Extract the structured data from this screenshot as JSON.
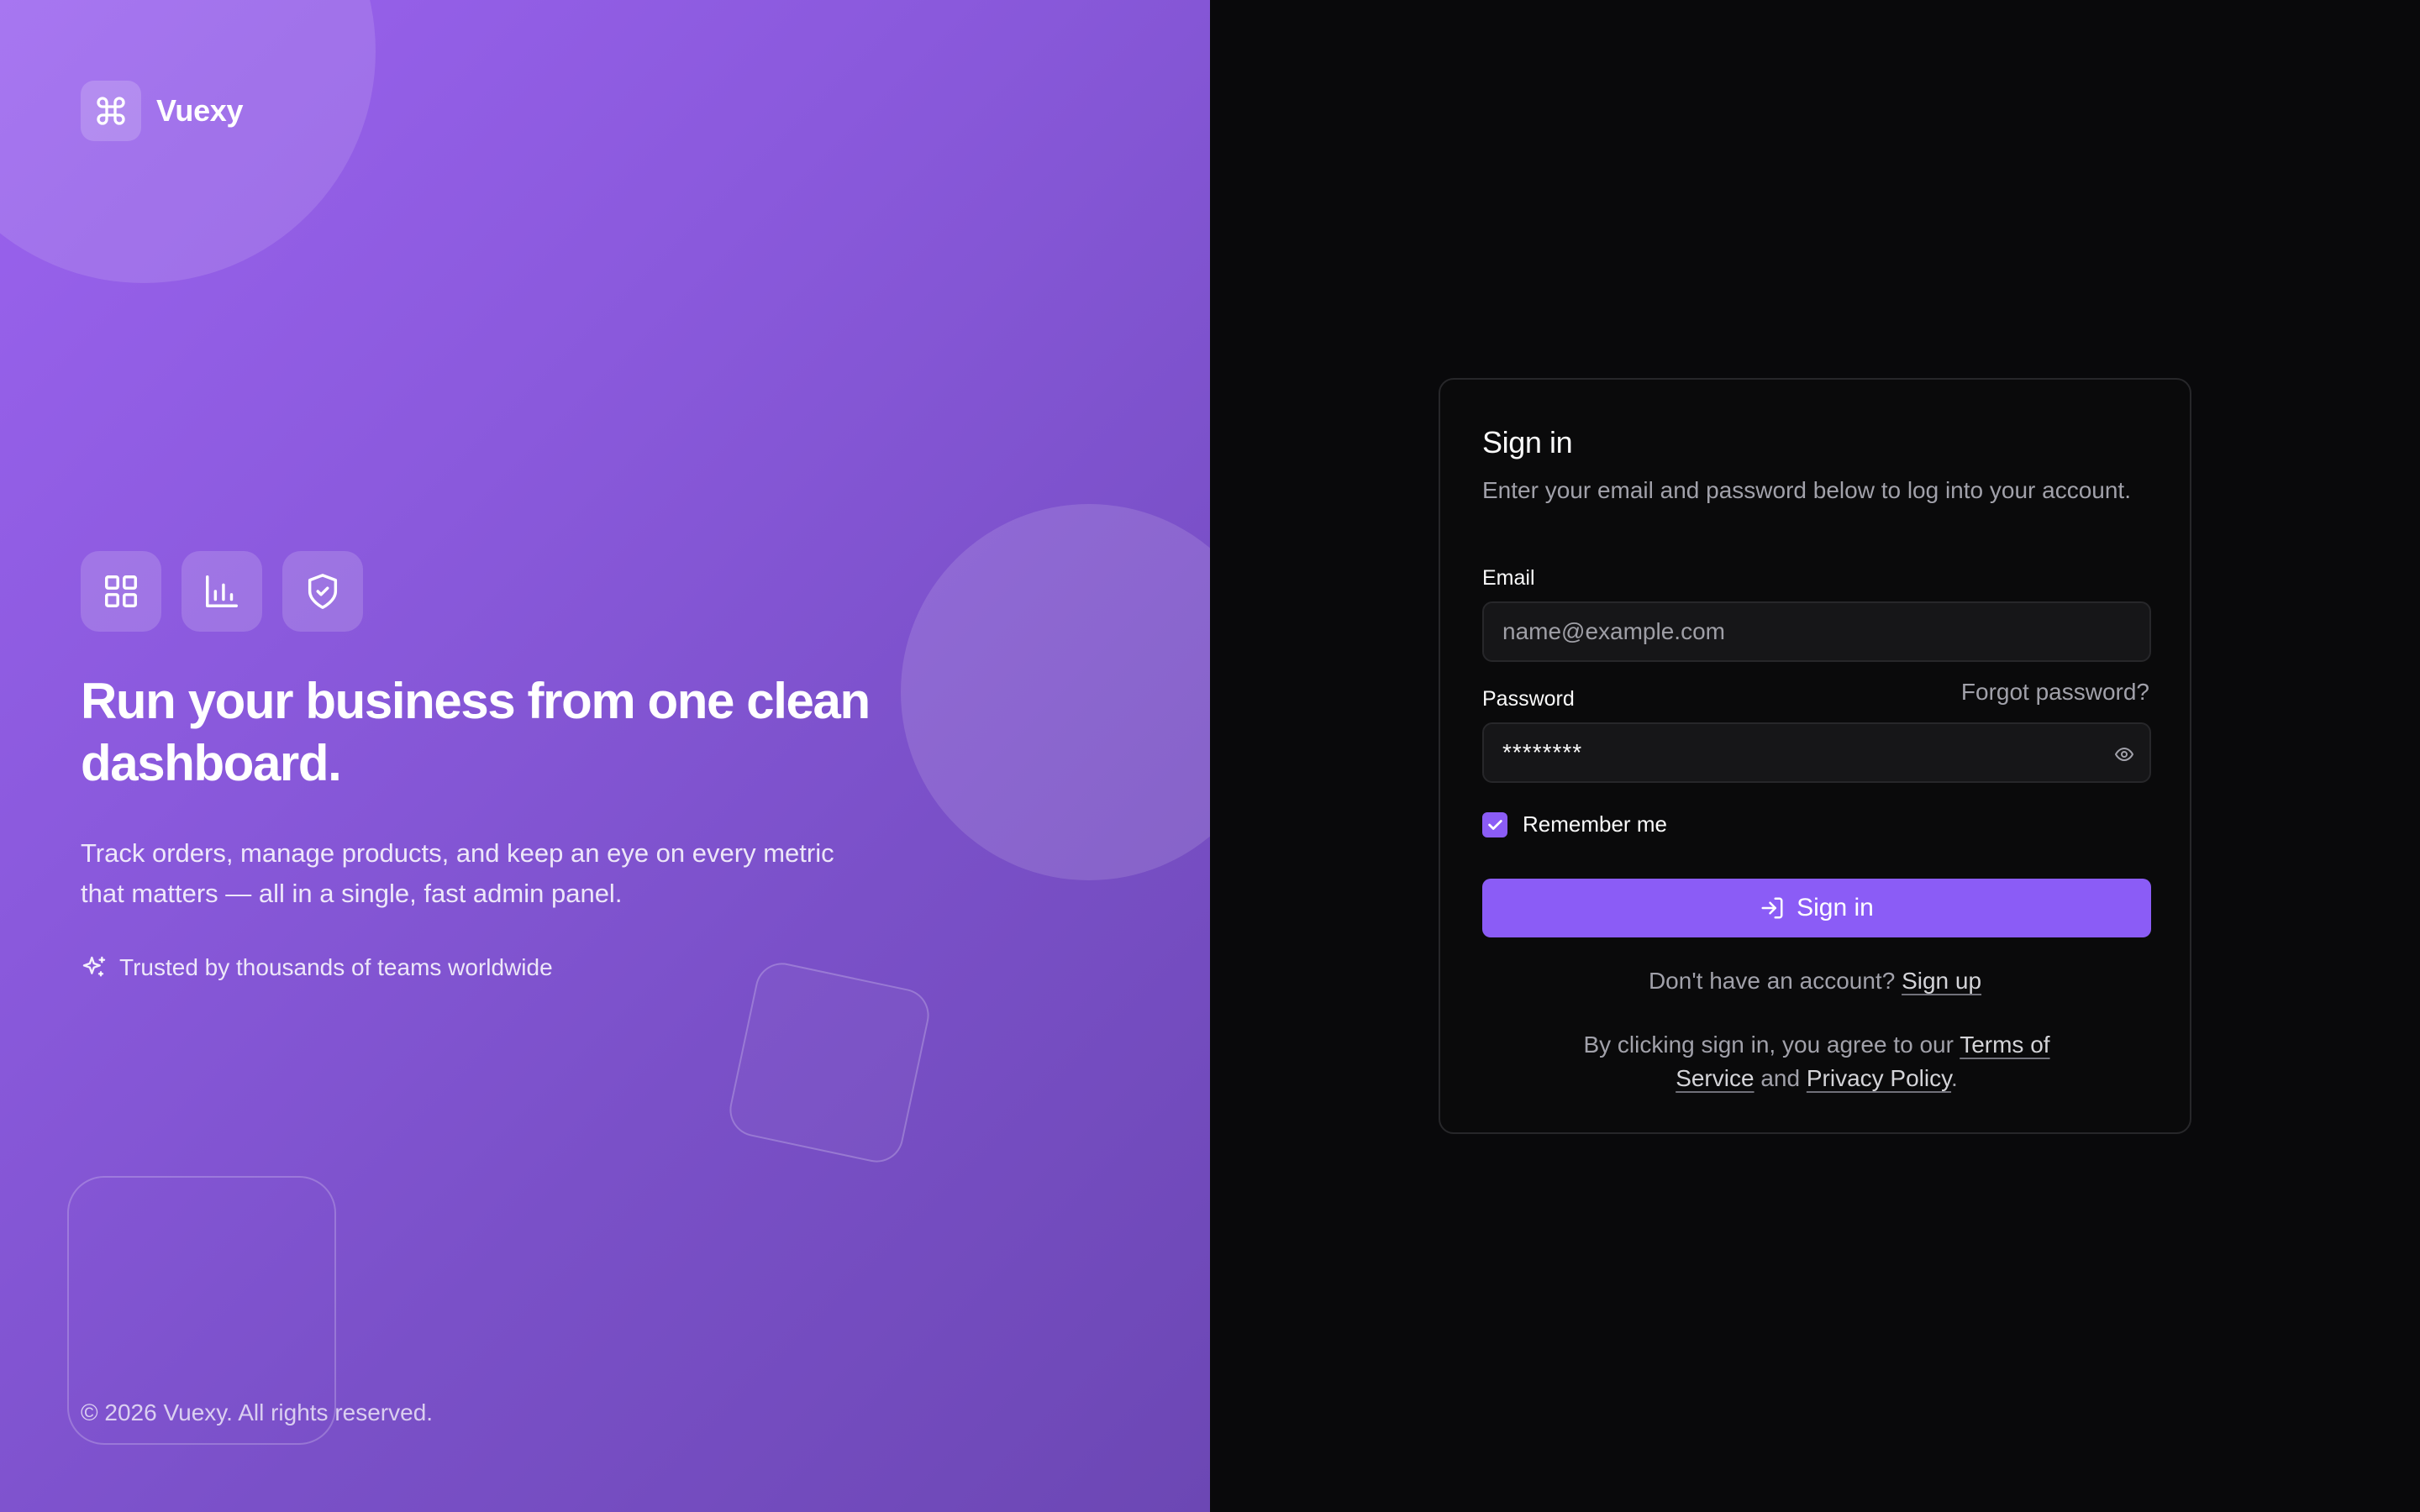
{
  "brand": {
    "name": "Vuexy",
    "icon": "command-icon"
  },
  "hero": {
    "feature_icons": [
      "grid-icon",
      "bar-chart-icon",
      "shield-check-icon"
    ],
    "title": "Run your business from one clean dashboard.",
    "subtitle": "Track orders, manage products, and keep an eye on every metric that matters — all in a single, fast admin panel.",
    "trusted": "Trusted by thousands of teams worldwide",
    "copyright": "© 2026 Vuexy. All rights reserved."
  },
  "signin": {
    "title": "Sign in",
    "description": "Enter your email and password below to log into your account.",
    "email_label": "Email",
    "email_placeholder": "name@example.com",
    "email_value": "",
    "password_label": "Password",
    "password_value": "********",
    "forgot_label": "Forgot password?",
    "remember_label": "Remember me",
    "remember_checked": true,
    "button_label": "Sign in",
    "no_account_text": "Don't have an account?",
    "signup_label": "Sign up",
    "legal_prefix": "By clicking sign in, you agree to our",
    "terms_label": "Terms of Service",
    "legal_and": "and",
    "privacy_label": "Privacy Policy",
    "legal_suffix": "."
  },
  "colors": {
    "accent": "#8b5cf6",
    "hero_gradient_start": "#9b63ef",
    "hero_gradient_end": "#6c47b4",
    "panel_bg": "#09090b",
    "border": "#27272a",
    "muted_text": "#a1a1aa"
  }
}
